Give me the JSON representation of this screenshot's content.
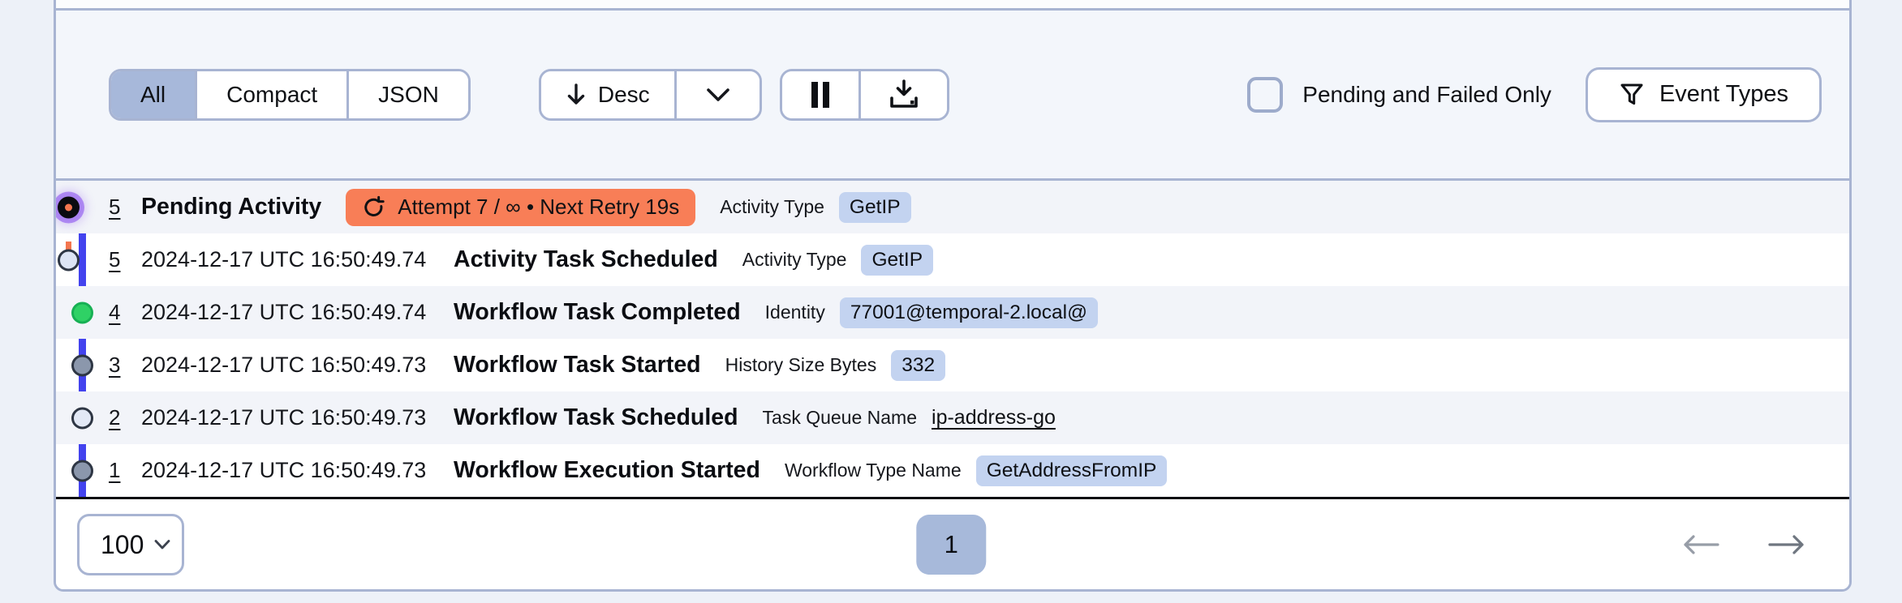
{
  "toolbar": {
    "view_tabs": [
      {
        "label": "All",
        "selected": true
      },
      {
        "label": "Compact",
        "selected": false
      },
      {
        "label": "JSON",
        "selected": false
      }
    ],
    "sort_label": "Desc",
    "pending_failed_label": "Pending and Failed Only",
    "event_types_label": "Event Types",
    "icons": [
      "arrow-down-icon",
      "chevron-down-icon",
      "pause-icon",
      "download-icon",
      "filter-funnel-icon"
    ]
  },
  "events": [
    {
      "id": "5",
      "time": "",
      "name": "Pending Activity",
      "retry_badge": "Attempt 7 / ∞ • Next Retry 19s",
      "attr_label": "Activity Type",
      "attr_value": "GetIP",
      "value_style": "badge",
      "marker": "pending"
    },
    {
      "id": "5",
      "time": "2024-12-17 UTC 16:50:49.74",
      "name": "Activity Task Scheduled",
      "attr_label": "Activity Type",
      "attr_value": "GetIP",
      "value_style": "badge",
      "marker": "hollow-left"
    },
    {
      "id": "4",
      "time": "2024-12-17 UTC 16:50:49.74",
      "name": "Workflow Task Completed",
      "attr_label": "Identity",
      "attr_value": "77001@temporal-2.local@",
      "value_style": "badge",
      "marker": "green"
    },
    {
      "id": "3",
      "time": "2024-12-17 UTC 16:50:49.73",
      "name": "Workflow Task Started",
      "attr_label": "History Size Bytes",
      "attr_value": "332",
      "value_style": "badge",
      "marker": "gray"
    },
    {
      "id": "2",
      "time": "2024-12-17 UTC 16:50:49.73",
      "name": "Workflow Task Scheduled",
      "attr_label": "Task Queue Name",
      "attr_value": "ip-address-go",
      "value_style": "link",
      "marker": "light"
    },
    {
      "id": "1",
      "time": "2024-12-17 UTC 16:50:49.73",
      "name": "Workflow Execution Started",
      "attr_label": "Workflow Type Name",
      "attr_value": "GetAddressFromIP",
      "value_style": "badge",
      "marker": "gray"
    }
  ],
  "pagination": {
    "page_size": "100",
    "current_page": "1"
  },
  "colors": {
    "page_bg": "#edf1f8",
    "card_border": "#a8b4d2",
    "selected_segment_bg": "#a7b8da",
    "toolbar_bg": "#f3f6fb",
    "row_stripe_bg": "#f2f4f9",
    "value_badge_bg": "#c3d3f0",
    "pending_badge_bg": "#f87e57",
    "timeline_line": "#4343ee",
    "timeline_dashed": "#f4764f",
    "node_green": "#2fd165",
    "node_gray": "#8b97ac",
    "node_light": "#e3e9f6",
    "end_of_history_line": "#0c0d12"
  }
}
